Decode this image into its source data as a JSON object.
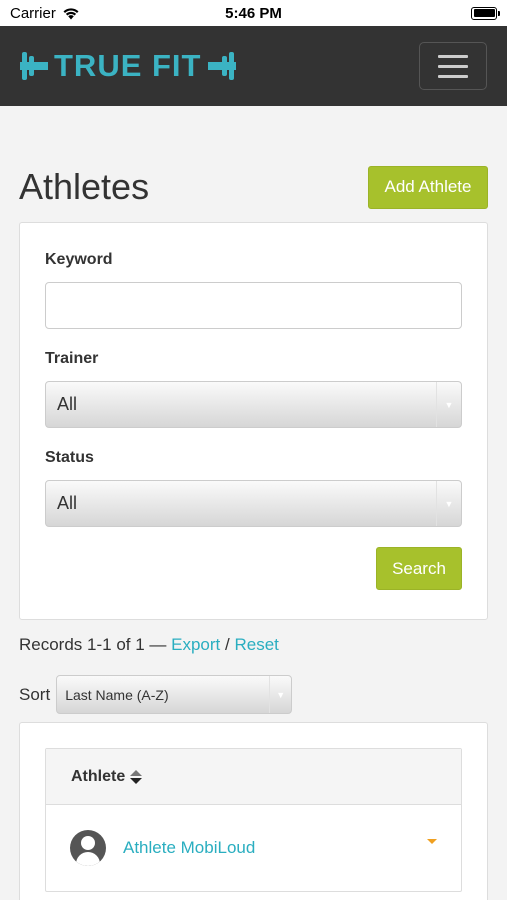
{
  "status_bar": {
    "carrier": "Carrier",
    "time": "5:46 PM"
  },
  "brand": {
    "logo_text": "TRUE FIT",
    "accent_color": "#3bb3c3"
  },
  "page": {
    "title": "Athletes",
    "add_button": "Add Athlete"
  },
  "filters": {
    "keyword_label": "Keyword",
    "keyword_value": "",
    "trainer_label": "Trainer",
    "trainer_value": "All",
    "status_label": "Status",
    "status_value": "All",
    "search_button": "Search"
  },
  "records": {
    "summary": "Records 1-1 of 1 —",
    "export_link": "Export",
    "separator": "/",
    "reset_link": "Reset"
  },
  "sort": {
    "label": "Sort",
    "value": "Last Name (A-Z)"
  },
  "table": {
    "header": "Athlete",
    "rows": [
      {
        "name": "Athlete MobiLoud"
      }
    ]
  },
  "colors": {
    "primary_button": "#a7c12c",
    "link": "#2aaec0",
    "navbar": "#333333"
  }
}
